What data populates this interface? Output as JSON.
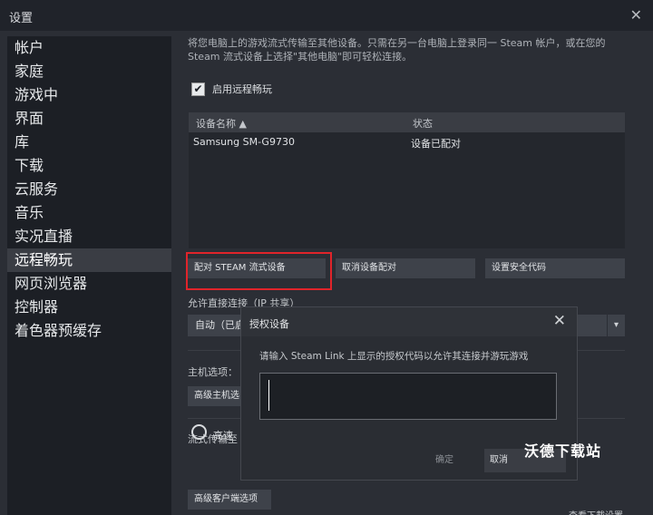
{
  "window": {
    "title": "设置"
  },
  "sidebar": {
    "items": [
      {
        "label": "帐户"
      },
      {
        "label": "家庭"
      },
      {
        "label": "游戏中"
      },
      {
        "label": "界面"
      },
      {
        "label": "库"
      },
      {
        "label": "下载"
      },
      {
        "label": "云服务"
      },
      {
        "label": "音乐"
      },
      {
        "label": "实况直播"
      },
      {
        "label": "远程畅玩",
        "active": true
      },
      {
        "label": "网页浏览器"
      },
      {
        "label": "控制器"
      },
      {
        "label": "着色器预缓存"
      }
    ]
  },
  "main": {
    "description": "将您电脑上的游戏流式传输至其他设备。只需在另一台电脑上登录同一 Steam 帐户，或在您的 Steam 流式设备上选择\"其他电脑\"即可轻松连接。",
    "enable_checkbox": {
      "label": "启用远程畅玩",
      "checked": true,
      "glyph": "✔"
    },
    "device_table": {
      "col_name": "设备名称 ▲",
      "col_status": "状态",
      "rows": [
        {
          "name": "Samsung SM-G9730",
          "status": "设备已配对"
        }
      ]
    },
    "buttons": {
      "pair": "配对 STEAM 流式设备",
      "unpair": "取消设备配对",
      "security_code": "设置安全代码"
    },
    "direct_connection": {
      "label": "允许直接连接（IP 共享）",
      "selected": "自动（已启",
      "arrow": "▾"
    },
    "host_options": {
      "label": "主机选项：",
      "button": "高级主机选"
    },
    "streaming": {
      "label": "流式传输至",
      "radio_label": "高速"
    },
    "client_options_button": "高级客户端选项",
    "bottom_partial": "查看下載设置"
  },
  "dialog": {
    "title": "授权设备",
    "close_glyph": "✕",
    "prompt": "请输入 Steam Link 上显示的授权代码以允许其连接并游玩游戏",
    "input_value": "",
    "confirm_label": "确定",
    "cancel_label": "取消"
  },
  "watermark": "沃德下载站",
  "colors": {
    "highlight_border": "#e0242a",
    "background": "#2b2e35",
    "sidebar": "#1c1f25"
  }
}
